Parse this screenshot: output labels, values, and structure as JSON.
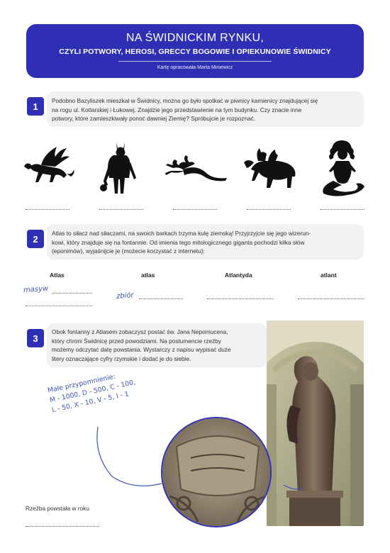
{
  "header": {
    "title": "NA ŚWIDNICKIM RYNKU,",
    "subtitle": "CZYLI POTWORY, HEROSI, GRECCY BOGOWIE I OPIEKUNOWIE ŚWIDNICY",
    "author": "Kartę opracowała Marta Miniewicz"
  },
  "task1": {
    "number": "1",
    "lines": [
      "Podobno Bazyliszek mieszkał w Świdnicy, można go było spotkać w piwnicy kamienicy znajdującej się",
      "na rogu ul. Kotlarskiej i Łukowej. Znajdzie jego przedstawienie na tym budynku. Czy znacie inne",
      "potwory, które zamieszkiwały ponoć dawniej Ziemię? Spróbujcie je rozpoznać."
    ],
    "figures": [
      "griffin-silhouette",
      "minotaur-silhouette",
      "hydra-silhouette",
      "chimera-silhouette",
      "medusa-silhouette"
    ]
  },
  "task2": {
    "number": "2",
    "lines": [
      "Atlas to siłacz nad siłaczami, na swoich barkach trzyma kulę ziemską! Przyjrzyjcie się jego wizerun-",
      "kowi, który znajduje się na fontannie. Od imienia tego mitologicznego giganta pochodzi kilka słów",
      "(eponimów), wyjaśnijcie je (możecie korzystać z internetu):"
    ],
    "words": [
      "Atlas",
      "atlas",
      "Atlantyda",
      "atlant"
    ],
    "handwritten": [
      "masyw",
      "zbiór"
    ]
  },
  "task3": {
    "number": "3",
    "lines": [
      "Obok fontanny z Atlasem zobaczysz postać św. Jana Nepomucena,",
      "który chroni Świdnicę przed powodziami. Na postumencie rzeźby",
      "możemy odczytać datę powstania. Wystarczy z napisu wypisać duże",
      "litery oznaczające cyfry rzymskie i dodać je do siebie."
    ],
    "note_lines": [
      "Małe przypomnienie:",
      "M - 1000, D - 500, C - 100,",
      "L - 50, X - 10, V - 5, I - 1"
    ],
    "answer_label": "Rzeźba powstała w roku"
  }
}
